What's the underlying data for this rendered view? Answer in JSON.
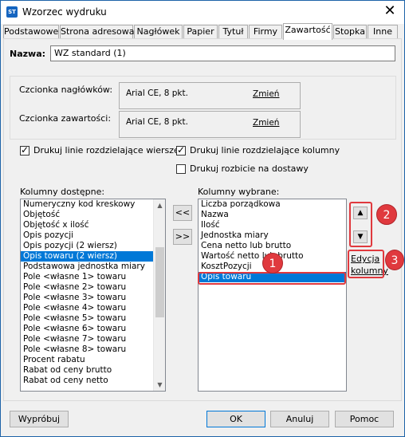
{
  "window": {
    "title": "Wzorzec wydruku",
    "app_icon_text": "ST"
  },
  "tabs": [
    {
      "label": "Podstawowe"
    },
    {
      "label": "Strona adresowa"
    },
    {
      "label": "Nagłówek"
    },
    {
      "label": "Papier"
    },
    {
      "label": "Tytuł"
    },
    {
      "label": "Firmy"
    },
    {
      "label": "Zawartość"
    },
    {
      "label": "Stopka"
    },
    {
      "label": "Inne"
    }
  ],
  "active_tab": "Zawartość",
  "name": {
    "label": "Nazwa:",
    "value": "WZ standard (1)"
  },
  "fonts": {
    "header_label": "Czcionka nagłówków:",
    "header_value": "Arial CE, 8 pkt.",
    "content_label": "Czcionka zawartości:",
    "content_value": "Arial CE, 8 pkt.",
    "change_label": "Zmień"
  },
  "checkboxes": {
    "row_lines": {
      "label": "Drukuj linie rozdzielające wiersze",
      "checked": true
    },
    "col_lines": {
      "label": "Drukuj linie rozdzielające kolumny",
      "checked": true
    },
    "split_delivery": {
      "label": "Drukuj rozbicie na dostawy",
      "checked": false
    }
  },
  "available": {
    "label": "Kolumny dostępne:",
    "items": [
      "Numeryczny kod kreskowy",
      "Objętość",
      "Objętość x ilość",
      "Opis pozycji",
      "Opis pozycji (2 wiersz)",
      "Opis towaru (2 wiersz)",
      "Podstawowa jednostka miary",
      "Pole <własne 1> towaru",
      "Pole <własne 2> towaru",
      "Pole <własne 3> towaru",
      "Pole <własne 4> towaru",
      "Pole <własne 5> towaru",
      "Pole <własne 6> towaru",
      "Pole <własne 7> towaru",
      "Pole <własne 8> towaru",
      "Procent rabatu",
      "Rabat od ceny brutto",
      "Rabat od ceny netto"
    ],
    "selected": "Opis towaru (2 wiersz)"
  },
  "selected_cols": {
    "label": "Kolumny wybrane:",
    "items": [
      "Liczba porządkowa",
      "Nazwa",
      "Ilość",
      "Jednostka miary",
      "Cena netto lub brutto",
      "Wartość netto lub brutto",
      "KosztPozycji",
      "Opis towaru"
    ],
    "selected": "Opis towaru"
  },
  "move_buttons": {
    "left": "<<",
    "right": ">>"
  },
  "edit_column": {
    "line1": "Edycja",
    "line2": "kolumny"
  },
  "badges": {
    "one": "1",
    "two": "2",
    "three": "3"
  },
  "buttons": {
    "test": "Wypróbuj",
    "ok": "OK",
    "cancel": "Anuluj",
    "help": "Pomoc"
  },
  "colors": {
    "accent": "#0078d7",
    "highlight": "#e0393e"
  }
}
